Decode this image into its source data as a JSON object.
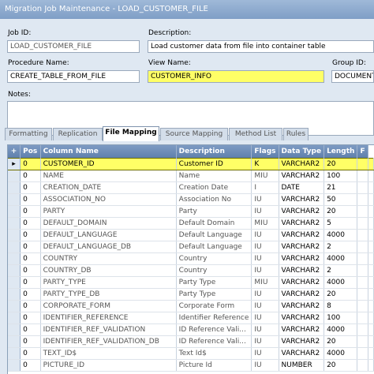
{
  "window": {
    "title": "Migration Job Maintenance - LOAD_CUSTOMER_FILE"
  },
  "form": {
    "job_id_label": "Job ID:",
    "job_id_value": "LOAD_CUSTOMER_FILE",
    "description_label": "Description:",
    "description_value": "Load customer data from file into container table",
    "procedure_name_label": "Procedure Name:",
    "procedure_name_value": "CREATE_TABLE_FROM_FILE",
    "view_name_label": "View Name:",
    "view_name_value": "CUSTOMER_INFO",
    "group_id_label": "Group ID:",
    "group_id_value": "DOCUMENTA",
    "notes_label": "Notes:"
  },
  "tabs": [
    {
      "label": "Formatting",
      "active": false
    },
    {
      "label": "Replication",
      "active": false
    },
    {
      "label": "File Mapping",
      "active": true
    },
    {
      "label": "Source Mapping",
      "active": false
    },
    {
      "label": "Method List",
      "active": false
    },
    {
      "label": "Rules",
      "active": false
    }
  ],
  "grid": {
    "add_symbol": "+",
    "current_row_marker": "▸",
    "columns": [
      "Pos",
      "Column Name",
      "Description",
      "Flags",
      "Data Type",
      "Length",
      "F"
    ],
    "rows": [
      {
        "pos": "0",
        "column_name": "CUSTOMER_ID",
        "description": "Customer ID",
        "flags": "K",
        "data_type": "VARCHAR2",
        "length": "20",
        "selected": true
      },
      {
        "pos": "0",
        "column_name": "NAME",
        "description": "Name",
        "flags": "MIU",
        "data_type": "VARCHAR2",
        "length": "100"
      },
      {
        "pos": "0",
        "column_name": "CREATION_DATE",
        "description": "Creation Date",
        "flags": "I",
        "data_type": "DATE",
        "length": "21"
      },
      {
        "pos": "0",
        "column_name": "ASSOCIATION_NO",
        "description": "Association No",
        "flags": "IU",
        "data_type": "VARCHAR2",
        "length": "50"
      },
      {
        "pos": "0",
        "column_name": "PARTY",
        "description": "Party",
        "flags": "IU",
        "data_type": "VARCHAR2",
        "length": "20"
      },
      {
        "pos": "0",
        "column_name": "DEFAULT_DOMAIN",
        "description": "Default Domain",
        "flags": "MIU",
        "data_type": "VARCHAR2",
        "length": "5"
      },
      {
        "pos": "0",
        "column_name": "DEFAULT_LANGUAGE",
        "description": "Default Language",
        "flags": "IU",
        "data_type": "VARCHAR2",
        "length": "4000"
      },
      {
        "pos": "0",
        "column_name": "DEFAULT_LANGUAGE_DB",
        "description": "Default Language",
        "flags": "IU",
        "data_type": "VARCHAR2",
        "length": "2"
      },
      {
        "pos": "0",
        "column_name": "COUNTRY",
        "description": "Country",
        "flags": "IU",
        "data_type": "VARCHAR2",
        "length": "4000"
      },
      {
        "pos": "0",
        "column_name": "COUNTRY_DB",
        "description": "Country",
        "flags": "IU",
        "data_type": "VARCHAR2",
        "length": "2"
      },
      {
        "pos": "0",
        "column_name": "PARTY_TYPE",
        "description": "Party Type",
        "flags": "MIU",
        "data_type": "VARCHAR2",
        "length": "4000"
      },
      {
        "pos": "0",
        "column_name": "PARTY_TYPE_DB",
        "description": "Party Type",
        "flags": "IU",
        "data_type": "VARCHAR2",
        "length": "20"
      },
      {
        "pos": "0",
        "column_name": "CORPORATE_FORM",
        "description": "Corporate Form",
        "flags": "IU",
        "data_type": "VARCHAR2",
        "length": "8"
      },
      {
        "pos": "0",
        "column_name": "IDENTIFIER_REFERENCE",
        "description": "Identifier Reference",
        "flags": "IU",
        "data_type": "VARCHAR2",
        "length": "100"
      },
      {
        "pos": "0",
        "column_name": "IDENTIFIER_REF_VALIDATION",
        "description": "ID Reference Vali...",
        "flags": "IU",
        "data_type": "VARCHAR2",
        "length": "4000"
      },
      {
        "pos": "0",
        "column_name": "IDENTIFIER_REF_VALIDATION_DB",
        "description": "ID Reference Vali...",
        "flags": "IU",
        "data_type": "VARCHAR2",
        "length": "20"
      },
      {
        "pos": "0",
        "column_name": "TEXT_ID$",
        "description": "Text Id$",
        "flags": "IU",
        "data_type": "VARCHAR2",
        "length": "4000"
      },
      {
        "pos": "0",
        "column_name": "PICTURE_ID",
        "description": "Picture Id",
        "flags": "IU",
        "data_type": "NUMBER",
        "length": "20"
      }
    ]
  }
}
